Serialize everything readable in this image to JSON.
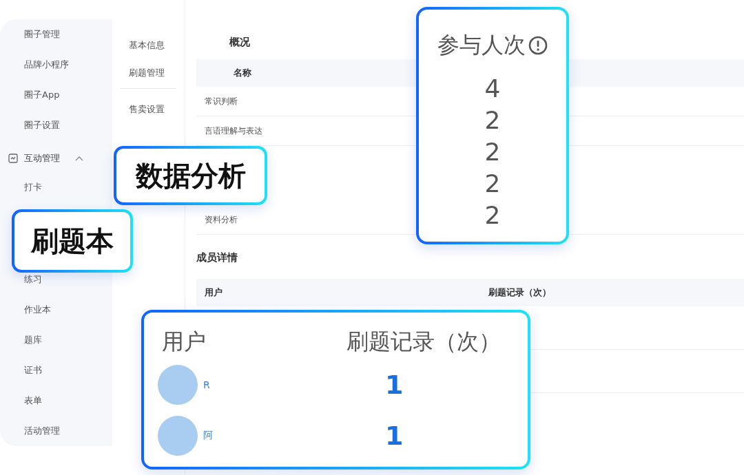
{
  "sidebar": {
    "items": [
      {
        "label": "圈子管理"
      },
      {
        "label": "品牌小程序"
      },
      {
        "label": "圈子App"
      },
      {
        "label": "圈子设置"
      }
    ],
    "group": {
      "label": "互动管理",
      "expanded": true,
      "children": [
        {
          "kind": "item",
          "label": "打卡"
        },
        {
          "kind": "callout",
          "label": "刷题本"
        },
        {
          "kind": "item",
          "label": "练习"
        },
        {
          "kind": "item",
          "label": "作业本"
        },
        {
          "kind": "item",
          "label": "题库"
        },
        {
          "kind": "item",
          "label": "证书"
        },
        {
          "kind": "item",
          "label": "表单"
        },
        {
          "kind": "item",
          "label": "活动管理"
        }
      ]
    }
  },
  "subnav": {
    "sections": [
      {
        "items": [
          "基本信息",
          "刷题管理"
        ]
      },
      {
        "items": [
          "售卖设置"
        ]
      }
    ]
  },
  "overview": {
    "title": "概况",
    "columns": [
      "名称"
    ],
    "rows": [
      {
        "kind": "row",
        "name": "常识判断"
      },
      {
        "kind": "row",
        "name": "言语理解与表达"
      },
      {
        "kind": "callout",
        "name": "数据分析"
      },
      {
        "kind": "row",
        "name": "资料分析"
      }
    ]
  },
  "participation_callout": {
    "title": "参与人次",
    "values": [
      "4",
      "2",
      "2",
      "2",
      "2"
    ]
  },
  "members": {
    "title": "成员详情",
    "columns": [
      "用户",
      "刷题记录（次）"
    ]
  },
  "member_callout": {
    "columns": [
      "用户",
      "刷题记录（次）"
    ],
    "rows": [
      {
        "user": "R",
        "count": "1"
      },
      {
        "user": "阿",
        "count": "1"
      }
    ]
  }
}
